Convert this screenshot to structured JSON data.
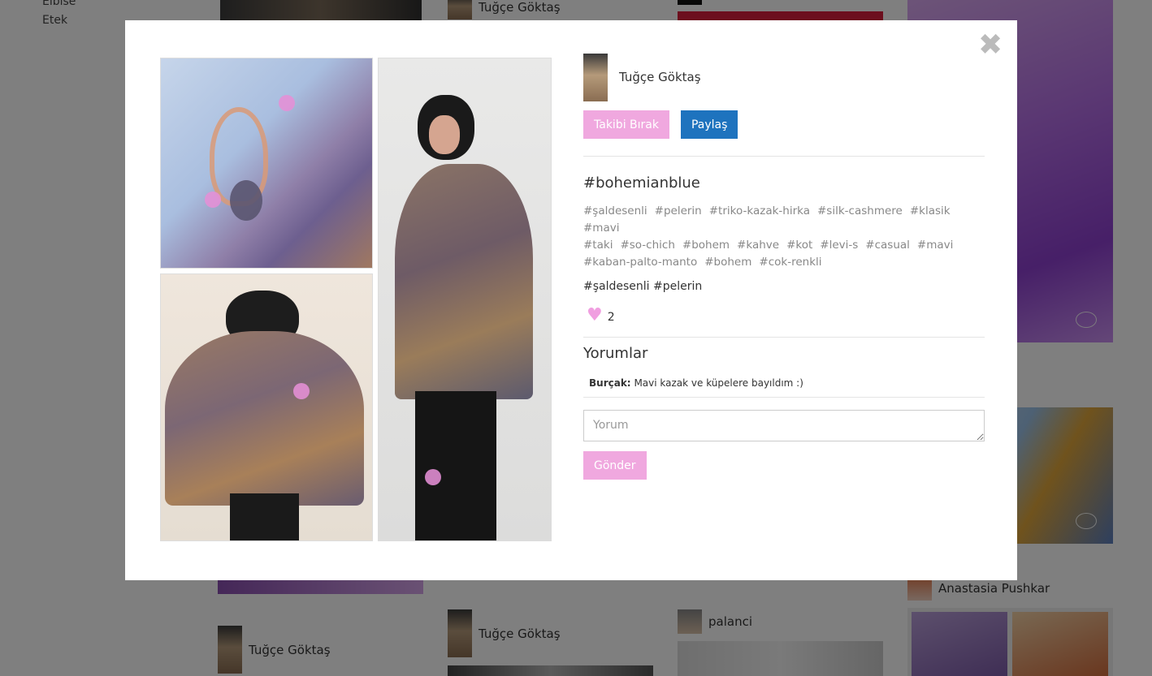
{
  "background": {
    "sidebar_links": [
      "Elbise",
      "Etek"
    ],
    "cards": [
      {
        "user": "Tuğçe Göktaş"
      },
      {
        "user": "Tuğçe Göktaş"
      },
      {
        "user": "Tuğçe Göktaş"
      },
      {
        "user": "palanci"
      },
      {
        "user": "Anastasia Pushkar"
      }
    ]
  },
  "modal": {
    "close_icon": "close-icon",
    "profile": {
      "name": "Tuğçe Göktaş"
    },
    "buttons": {
      "unfollow": "Takibi Bırak",
      "share": "Paylaş"
    },
    "hashtag_title": "#bohemianblue",
    "tags": [
      "#şaldesenli",
      "#pelerin",
      "#triko-kazak-hirka",
      "#silk-cashmere",
      "#klasik",
      "#mavi",
      "#taki",
      "#so-chich",
      "#bohem",
      "#kahve",
      "#kot",
      "#levi-s",
      "#casual",
      "#mavi",
      "#kaban-palto-manto",
      "#bohem",
      "#cok-renkli"
    ],
    "description": "#şaldesenli #pelerin",
    "likes": {
      "icon": "heart-icon",
      "count": "2"
    },
    "comments_title": "Yorumlar",
    "comments": [
      {
        "author": "Burçak:",
        "text": "Mavi kazak ve küpelere bayıldım :)"
      }
    ],
    "comment_input": {
      "placeholder": "Yorum",
      "value": ""
    },
    "send_label": "Gönder"
  },
  "colors": {
    "pink": "#f0a8df",
    "blue": "#1e73be",
    "dot": "#e58fd6"
  }
}
